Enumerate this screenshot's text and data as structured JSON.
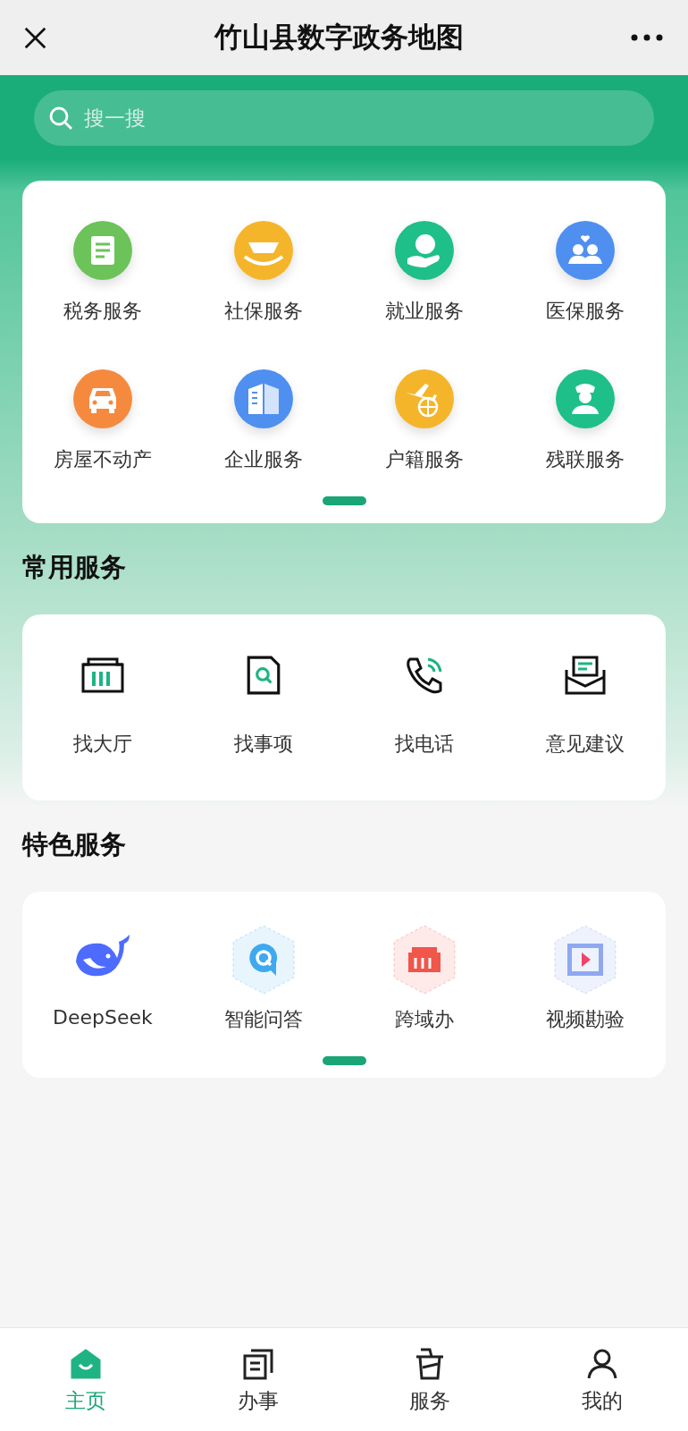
{
  "header": {
    "title": "竹山县数字政务地图"
  },
  "search": {
    "placeholder": "搜一搜"
  },
  "main_services": [
    {
      "label": "税务服务",
      "kind": "tax",
      "color": "#6cc35a"
    },
    {
      "label": "社保服务",
      "kind": "social",
      "color": "#f5b52a"
    },
    {
      "label": "就业服务",
      "kind": "job",
      "color": "#1fbf8a"
    },
    {
      "label": "医保服务",
      "kind": "medical",
      "color": "#4f8ff0"
    },
    {
      "label": "房屋不动产",
      "kind": "house",
      "color": "#f58a3f"
    },
    {
      "label": "企业服务",
      "kind": "company",
      "color": "#4f8ff0"
    },
    {
      "label": "户籍服务",
      "kind": "household",
      "color": "#f5b52a"
    },
    {
      "label": "残联服务",
      "kind": "disability",
      "color": "#1fbf8a"
    }
  ],
  "common_services": {
    "title": "常用服务",
    "items": [
      {
        "label": "找大厅",
        "kind": "hall"
      },
      {
        "label": "找事项",
        "kind": "item"
      },
      {
        "label": "找电话",
        "kind": "phone"
      },
      {
        "label": "意见建议",
        "kind": "feedback"
      }
    ]
  },
  "featured_services": {
    "title": "特色服务",
    "items": [
      {
        "label": "DeepSeek",
        "kind": "whale"
      },
      {
        "label": "智能问答",
        "kind": "qa",
        "color": "#3fa9f0"
      },
      {
        "label": "跨域办",
        "kind": "cross",
        "color": "#f0564a"
      },
      {
        "label": "视频勘验",
        "kind": "video",
        "color": "#8fa8f0"
      }
    ]
  },
  "tab_bar": [
    {
      "label": "主页",
      "kind": "home",
      "selected": true
    },
    {
      "label": "办事",
      "kind": "affairs",
      "selected": false
    },
    {
      "label": "服务",
      "kind": "service",
      "selected": false
    },
    {
      "label": "我的",
      "kind": "me",
      "selected": false
    }
  ]
}
